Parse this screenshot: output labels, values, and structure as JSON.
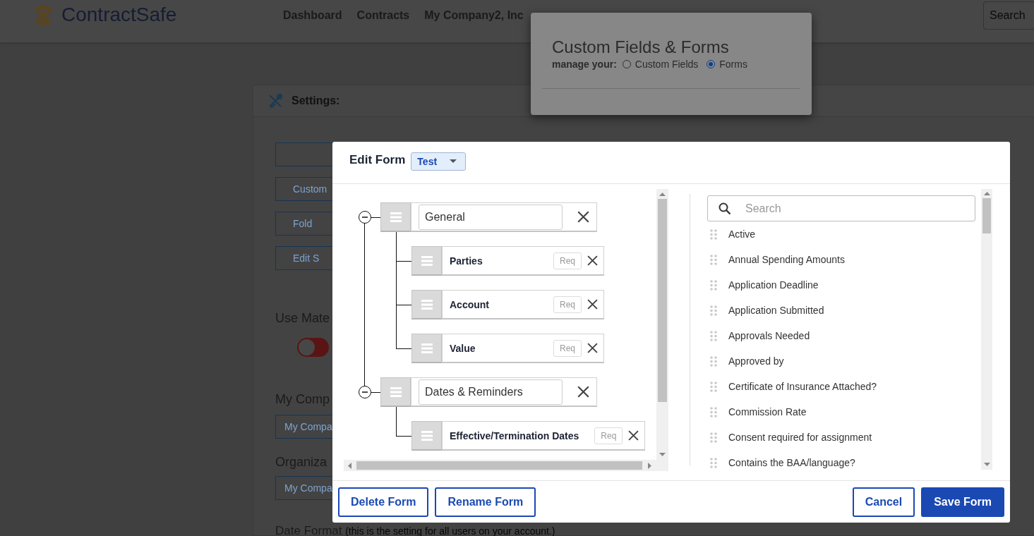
{
  "header": {
    "logo": "ContractSafe",
    "nav": [
      "Dashboard",
      "Contracts",
      "My Company2, Inc"
    ],
    "search": {
      "placeholder": "Search"
    }
  },
  "settings": {
    "title": "Settings:",
    "buttons": [
      "Custom",
      "Fold",
      "Edit S"
    ],
    "material_label": "Use Mate",
    "material_toggle": {
      "on": false
    },
    "company_label": "My Comp",
    "company_field": {
      "value": "My Compa"
    },
    "organization_label": "Organiza",
    "organization_field": {
      "value": "My Compa"
    },
    "date_format": {
      "label": "Date Format",
      "note": "(this is the setting for all users on your account.)"
    }
  },
  "custom_fields_popup": {
    "title": "Custom Fields & Forms",
    "manage_label": "manage your:",
    "options": [
      {
        "label": "Custom Fields",
        "selected": false
      },
      {
        "label": "Forms",
        "selected": true
      }
    ]
  },
  "edit_form": {
    "title": "Edit Form",
    "form_select": {
      "value": "Test"
    },
    "tree": [
      {
        "name": "General",
        "expanded": true,
        "children": [
          {
            "name": "Parties",
            "required_label": "Req",
            "required": false
          },
          {
            "name": "Account",
            "required_label": "Req",
            "required": false
          },
          {
            "name": "Value",
            "required_label": "Req",
            "required": false
          }
        ]
      },
      {
        "name": "Dates & Reminders",
        "expanded": true,
        "children": [
          {
            "name": "Effective/Termination Dates",
            "required_label": "Req",
            "required": false
          }
        ]
      }
    ],
    "field_search": {
      "placeholder": "Search"
    },
    "fields": [
      "Active",
      "Annual Spending Amounts",
      "Application Deadline",
      "Application Submitted",
      "Approvals Needed",
      "Approved by",
      "Certificate of Insurance Attached?",
      "Commission Rate",
      "Consent required for assignment",
      "Contains the BAA/language?"
    ],
    "buttons": [
      {
        "label": "Delete Form",
        "kind": "outline"
      },
      {
        "label": "Rename Form",
        "kind": "outline"
      },
      {
        "label": "Cancel",
        "kind": "outline"
      },
      {
        "label": "Save Form",
        "kind": "primary"
      }
    ]
  }
}
